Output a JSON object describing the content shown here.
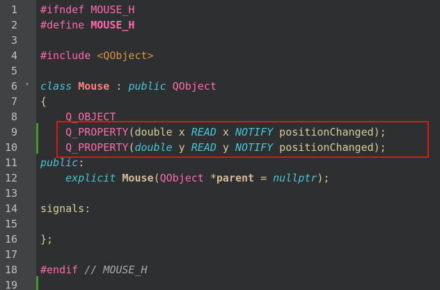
{
  "editor": {
    "lines": [
      {
        "num": "1",
        "segments": [
          {
            "t": "#ifndef MOUSE_H",
            "c": "pp"
          }
        ]
      },
      {
        "num": "2",
        "segments": [
          {
            "t": "#define ",
            "c": "pp"
          },
          {
            "t": "MOUSE_H",
            "c": "ppb"
          }
        ]
      },
      {
        "num": "3",
        "segments": []
      },
      {
        "num": "4",
        "segments": [
          {
            "t": "#include ",
            "c": "pp"
          },
          {
            "t": "<QObject>",
            "c": "str"
          }
        ]
      },
      {
        "num": "5",
        "segments": []
      },
      {
        "num": "6",
        "segments": [
          {
            "t": "class",
            "c": "kw"
          },
          {
            "t": " ",
            "c": "plain"
          },
          {
            "t": "Mouse",
            "c": "cls"
          },
          {
            "t": " : ",
            "c": "plain"
          },
          {
            "t": "public",
            "c": "kw"
          },
          {
            "t": " ",
            "c": "plain"
          },
          {
            "t": "QObject",
            "c": "macro"
          }
        ]
      },
      {
        "num": "7",
        "segments": [
          {
            "t": "{",
            "c": "plain"
          }
        ]
      },
      {
        "num": "8",
        "segments": [
          {
            "t": "    ",
            "c": "plain"
          },
          {
            "t": "Q_OBJECT",
            "c": "macro"
          }
        ]
      },
      {
        "num": "9",
        "segments": [
          {
            "t": "    ",
            "c": "plain"
          },
          {
            "t": "Q_PROPERTY",
            "c": "macro"
          },
          {
            "t": "(double x ",
            "c": "plain"
          },
          {
            "t": "READ",
            "c": "ital"
          },
          {
            "t": " x ",
            "c": "plain"
          },
          {
            "t": "NOTIFY",
            "c": "ital"
          },
          {
            "t": " positionChanged);",
            "c": "plain"
          }
        ]
      },
      {
        "num": "10",
        "segments": [
          {
            "t": "    ",
            "c": "plain"
          },
          {
            "t": "Q_PROPERTY",
            "c": "macro"
          },
          {
            "t": "(",
            "c": "plain"
          },
          {
            "t": "double",
            "c": "ital"
          },
          {
            "t": " y ",
            "c": "plain"
          },
          {
            "t": "READ",
            "c": "ital"
          },
          {
            "t": " y ",
            "c": "plain"
          },
          {
            "t": "NOTIFY",
            "c": "ital"
          },
          {
            "t": " positionChanged);",
            "c": "plain"
          }
        ]
      },
      {
        "num": "11",
        "segments": [
          {
            "t": "public",
            "c": "kw"
          },
          {
            "t": ":",
            "c": "plain"
          }
        ]
      },
      {
        "num": "12",
        "segments": [
          {
            "t": "    ",
            "c": "plain"
          },
          {
            "t": "explicit",
            "c": "kw"
          },
          {
            "t": " ",
            "c": "plain"
          },
          {
            "t": "Mouse",
            "c": "fn"
          },
          {
            "t": "(",
            "c": "plain"
          },
          {
            "t": "QObject",
            "c": "macro"
          },
          {
            "t": " *",
            "c": "plain"
          },
          {
            "t": "parent",
            "c": "param"
          },
          {
            "t": " = ",
            "c": "plain"
          },
          {
            "t": "nullptr",
            "c": "kw"
          },
          {
            "t": ");",
            "c": "plain"
          }
        ]
      },
      {
        "num": "13",
        "segments": []
      },
      {
        "num": "14",
        "segments": [
          {
            "t": "signals",
            "c": "plain"
          },
          {
            "t": ":",
            "c": "plain"
          }
        ]
      },
      {
        "num": "15",
        "segments": []
      },
      {
        "num": "16",
        "segments": [
          {
            "t": "};",
            "c": "plain"
          }
        ]
      },
      {
        "num": "17",
        "segments": []
      },
      {
        "num": "18",
        "segments": [
          {
            "t": "#endif ",
            "c": "pp"
          },
          {
            "t": "// MOUSE_H",
            "c": "cm"
          }
        ]
      },
      {
        "num": "19",
        "segments": []
      }
    ],
    "fold_icon": "fold-arrow-icon",
    "colors": {
      "background": "#2e2f30",
      "gutter": "#404244",
      "highlight_border": "#e01515",
      "change_bar": "#3d9b2f"
    }
  }
}
